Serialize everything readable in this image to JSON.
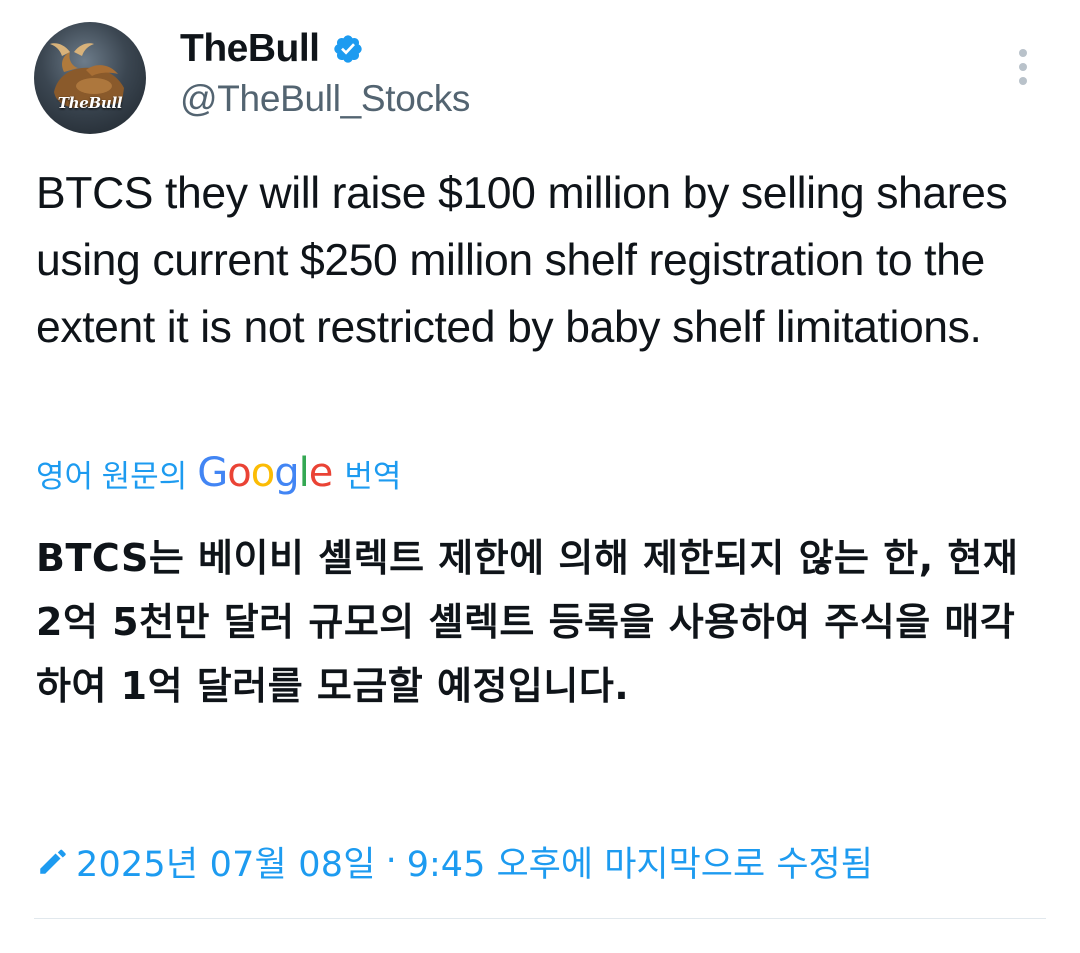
{
  "author": {
    "display_name": "TheBull",
    "handle": "@TheBull_Stocks",
    "avatar_logo_text": "TheBull",
    "verified": true,
    "verified_color": "#1d9bf0"
  },
  "tweet": {
    "text": "BTCS they will raise $100 million by selling shares using current $250 million shelf registration to the extent it is not restricted by baby shelf limitations."
  },
  "translation": {
    "prefix": "영어 원문의",
    "provider_logo_letters": [
      "G",
      "o",
      "o",
      "g",
      "l",
      "e"
    ],
    "suffix": "번역",
    "translated_text": "BTCS는 베이비 셸렉트 제한에 의해 제한되지 않는 한, 현재 2억 5천만 달러 규모의 셸렉트 등록을 사용하여 주식을 매각하여 1억 달러를 모금할 예정입니다.",
    "link_color": "#1d9bf0"
  },
  "edited_note": {
    "date": "2025년 07월 08일",
    "separator": "·",
    "text": "9:45 오후에 마지막으로 수정됨",
    "icon": "pencil-icon"
  },
  "icons": {
    "more": "more-vertical-icon",
    "verified": "verified-badge-icon",
    "edit": "pencil-icon"
  }
}
